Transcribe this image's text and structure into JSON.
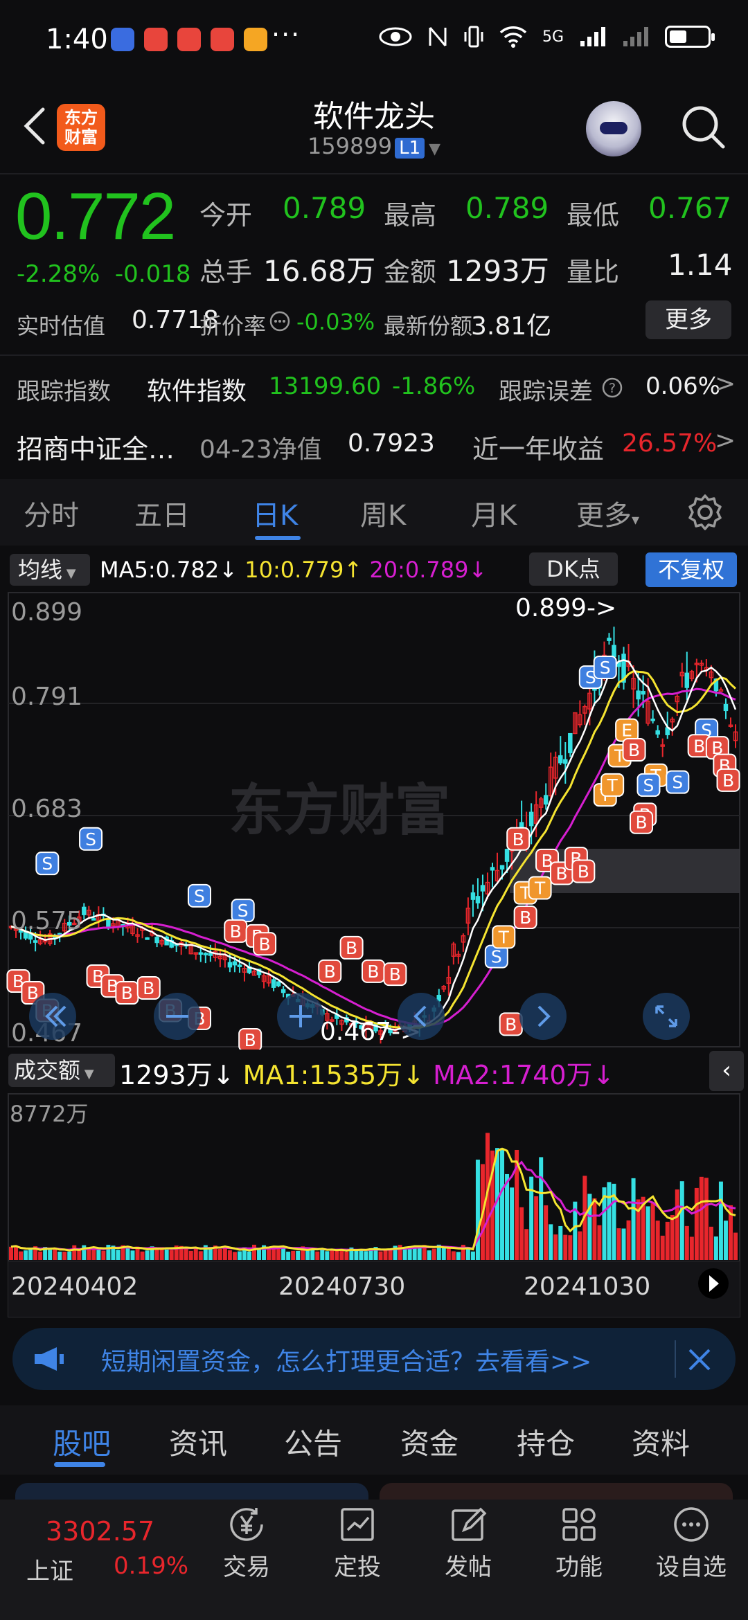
{
  "status_bar": {
    "time": "1:40",
    "dots": "···",
    "network": "5G"
  },
  "header": {
    "title": "软件龙头",
    "code": "159899",
    "level": "L1",
    "logo_text": [
      "东方",
      "财富"
    ]
  },
  "quote": {
    "price": "0.772",
    "change_pct": "-2.28%",
    "change": "-0.018",
    "open_label": "今开",
    "open": "0.789",
    "high_label": "最高",
    "high": "0.789",
    "low_label": "最低",
    "low": "0.767",
    "volume_label": "总手",
    "volume": "16.68万",
    "amount_label": "金额",
    "amount": "1293万",
    "ratio_label": "量比",
    "ratio": "1.14",
    "iopv_label": "实时估值",
    "iopv": "0.7718",
    "premium_label": "折价率",
    "premium": "-0.03%",
    "shares_label": "最新份额",
    "shares": "3.81亿",
    "more_label": "更多"
  },
  "tracking": {
    "label": "跟踪指数",
    "index_name": "软件指数",
    "index_value": "13199.60",
    "index_change": "-1.86%",
    "error_label": "跟踪误差",
    "error_value": "0.06%"
  },
  "fund": {
    "name": "招商中证全…",
    "nav_label": "04-23净值",
    "nav": "0.7923",
    "yield_label": "近一年收益",
    "yield": "26.57%"
  },
  "chart_tabs": [
    "分时",
    "五日",
    "日K",
    "周K",
    "月K",
    "更多"
  ],
  "active_chart_tab": "日K",
  "kline": {
    "ma_selector": "均线",
    "ma5": "MA5:0.782↓",
    "ma10": "10:0.779↑",
    "ma20": "20:0.789↓",
    "dk_label": "DK点",
    "adjust_label": "不复权",
    "y_labels": [
      "0.899",
      "0.791",
      "0.683",
      "0.575",
      "0.467"
    ],
    "high_marker": "0.899->",
    "low_marker": "0.467->",
    "watermark": "东方财富",
    "colors": {
      "ma5": "#ffffff",
      "ma10": "#f5e431",
      "ma20": "#d61fd0",
      "up": "#e8262c",
      "down": "#35e0e3"
    }
  },
  "volume": {
    "selector": "成交额",
    "current": "1293万↓",
    "ma1": "MA1:1535万↓",
    "ma2": "MA2:1740万↓",
    "max_label": "8772万",
    "dates": [
      "20240402",
      "20240730",
      "20241030"
    ]
  },
  "banner": {
    "text": "短期闲置资金，怎么打理更合适？去看看>>"
  },
  "bottom_tabs": [
    "股吧",
    "资讯",
    "公告",
    "资金",
    "持仓",
    "资料"
  ],
  "active_bottom_tab": "股吧",
  "bottom_nav": {
    "index_value": "3302.57",
    "index_name": "上证",
    "index_change": "0.19%",
    "items": [
      {
        "label": "交易",
        "icon": "yen-icon"
      },
      {
        "label": "定投",
        "icon": "chart-frame-icon"
      },
      {
        "label": "发帖",
        "icon": "pen-icon"
      },
      {
        "label": "功能",
        "icon": "grid-icon"
      },
      {
        "label": "设自选",
        "icon": "more-icon"
      }
    ]
  }
}
